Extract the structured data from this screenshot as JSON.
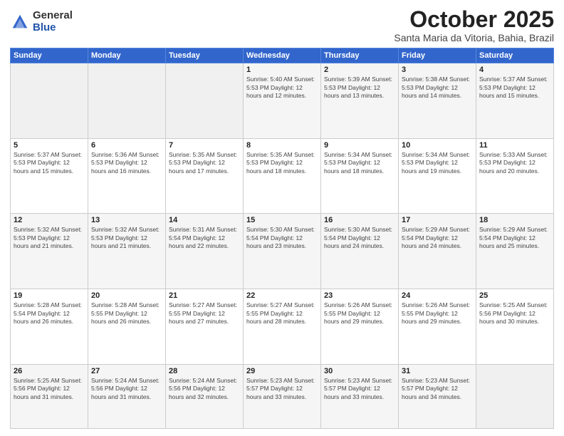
{
  "header": {
    "logo_general": "General",
    "logo_blue": "Blue",
    "month_title": "October 2025",
    "location": "Santa Maria da Vitoria, Bahia, Brazil"
  },
  "days_of_week": [
    "Sunday",
    "Monday",
    "Tuesday",
    "Wednesday",
    "Thursday",
    "Friday",
    "Saturday"
  ],
  "weeks": [
    [
      {
        "day": "",
        "info": ""
      },
      {
        "day": "",
        "info": ""
      },
      {
        "day": "",
        "info": ""
      },
      {
        "day": "1",
        "info": "Sunrise: 5:40 AM\nSunset: 5:53 PM\nDaylight: 12 hours\nand 12 minutes."
      },
      {
        "day": "2",
        "info": "Sunrise: 5:39 AM\nSunset: 5:53 PM\nDaylight: 12 hours\nand 13 minutes."
      },
      {
        "day": "3",
        "info": "Sunrise: 5:38 AM\nSunset: 5:53 PM\nDaylight: 12 hours\nand 14 minutes."
      },
      {
        "day": "4",
        "info": "Sunrise: 5:37 AM\nSunset: 5:53 PM\nDaylight: 12 hours\nand 15 minutes."
      }
    ],
    [
      {
        "day": "5",
        "info": "Sunrise: 5:37 AM\nSunset: 5:53 PM\nDaylight: 12 hours\nand 15 minutes."
      },
      {
        "day": "6",
        "info": "Sunrise: 5:36 AM\nSunset: 5:53 PM\nDaylight: 12 hours\nand 16 minutes."
      },
      {
        "day": "7",
        "info": "Sunrise: 5:35 AM\nSunset: 5:53 PM\nDaylight: 12 hours\nand 17 minutes."
      },
      {
        "day": "8",
        "info": "Sunrise: 5:35 AM\nSunset: 5:53 PM\nDaylight: 12 hours\nand 18 minutes."
      },
      {
        "day": "9",
        "info": "Sunrise: 5:34 AM\nSunset: 5:53 PM\nDaylight: 12 hours\nand 18 minutes."
      },
      {
        "day": "10",
        "info": "Sunrise: 5:34 AM\nSunset: 5:53 PM\nDaylight: 12 hours\nand 19 minutes."
      },
      {
        "day": "11",
        "info": "Sunrise: 5:33 AM\nSunset: 5:53 PM\nDaylight: 12 hours\nand 20 minutes."
      }
    ],
    [
      {
        "day": "12",
        "info": "Sunrise: 5:32 AM\nSunset: 5:53 PM\nDaylight: 12 hours\nand 21 minutes."
      },
      {
        "day": "13",
        "info": "Sunrise: 5:32 AM\nSunset: 5:53 PM\nDaylight: 12 hours\nand 21 minutes."
      },
      {
        "day": "14",
        "info": "Sunrise: 5:31 AM\nSunset: 5:54 PM\nDaylight: 12 hours\nand 22 minutes."
      },
      {
        "day": "15",
        "info": "Sunrise: 5:30 AM\nSunset: 5:54 PM\nDaylight: 12 hours\nand 23 minutes."
      },
      {
        "day": "16",
        "info": "Sunrise: 5:30 AM\nSunset: 5:54 PM\nDaylight: 12 hours\nand 24 minutes."
      },
      {
        "day": "17",
        "info": "Sunrise: 5:29 AM\nSunset: 5:54 PM\nDaylight: 12 hours\nand 24 minutes."
      },
      {
        "day": "18",
        "info": "Sunrise: 5:29 AM\nSunset: 5:54 PM\nDaylight: 12 hours\nand 25 minutes."
      }
    ],
    [
      {
        "day": "19",
        "info": "Sunrise: 5:28 AM\nSunset: 5:54 PM\nDaylight: 12 hours\nand 26 minutes."
      },
      {
        "day": "20",
        "info": "Sunrise: 5:28 AM\nSunset: 5:55 PM\nDaylight: 12 hours\nand 26 minutes."
      },
      {
        "day": "21",
        "info": "Sunrise: 5:27 AM\nSunset: 5:55 PM\nDaylight: 12 hours\nand 27 minutes."
      },
      {
        "day": "22",
        "info": "Sunrise: 5:27 AM\nSunset: 5:55 PM\nDaylight: 12 hours\nand 28 minutes."
      },
      {
        "day": "23",
        "info": "Sunrise: 5:26 AM\nSunset: 5:55 PM\nDaylight: 12 hours\nand 29 minutes."
      },
      {
        "day": "24",
        "info": "Sunrise: 5:26 AM\nSunset: 5:55 PM\nDaylight: 12 hours\nand 29 minutes."
      },
      {
        "day": "25",
        "info": "Sunrise: 5:25 AM\nSunset: 5:56 PM\nDaylight: 12 hours\nand 30 minutes."
      }
    ],
    [
      {
        "day": "26",
        "info": "Sunrise: 5:25 AM\nSunset: 5:56 PM\nDaylight: 12 hours\nand 31 minutes."
      },
      {
        "day": "27",
        "info": "Sunrise: 5:24 AM\nSunset: 5:56 PM\nDaylight: 12 hours\nand 31 minutes."
      },
      {
        "day": "28",
        "info": "Sunrise: 5:24 AM\nSunset: 5:56 PM\nDaylight: 12 hours\nand 32 minutes."
      },
      {
        "day": "29",
        "info": "Sunrise: 5:23 AM\nSunset: 5:57 PM\nDaylight: 12 hours\nand 33 minutes."
      },
      {
        "day": "30",
        "info": "Sunrise: 5:23 AM\nSunset: 5:57 PM\nDaylight: 12 hours\nand 33 minutes."
      },
      {
        "day": "31",
        "info": "Sunrise: 5:23 AM\nSunset: 5:57 PM\nDaylight: 12 hours\nand 34 minutes."
      },
      {
        "day": "",
        "info": ""
      }
    ]
  ]
}
